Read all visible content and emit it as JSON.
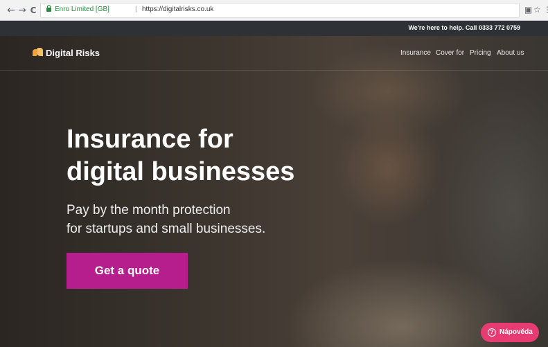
{
  "browser": {
    "back_icon": "←",
    "forward_icon": "→",
    "reload_icon": "C",
    "secure_label": "Enro Limited [GB]",
    "url": "https://digitalrisks.co.uk",
    "translate_icon": "▣",
    "star_icon": "☆",
    "menu_icon": "⋮"
  },
  "topbar": {
    "help_text": "We're here to help. Call 0333 772 0759"
  },
  "site": {
    "brand": "Digital Risks",
    "nav": [
      "Insurance",
      "Cover for",
      "Pricing",
      "About us"
    ]
  },
  "hero": {
    "headline_line1": "Insurance for",
    "headline_line2": "digital businesses",
    "sub_line1": "Pay by the month protection",
    "sub_line2": "for startups and small businesses.",
    "cta": "Get a quote"
  },
  "help_widget": {
    "icon": "?",
    "label": "Nápověda"
  },
  "colors": {
    "cta": "#b51e8c",
    "help_pill": "#e73b73",
    "topbar": "#2e3136",
    "logo_primary": "#f2a23a"
  }
}
